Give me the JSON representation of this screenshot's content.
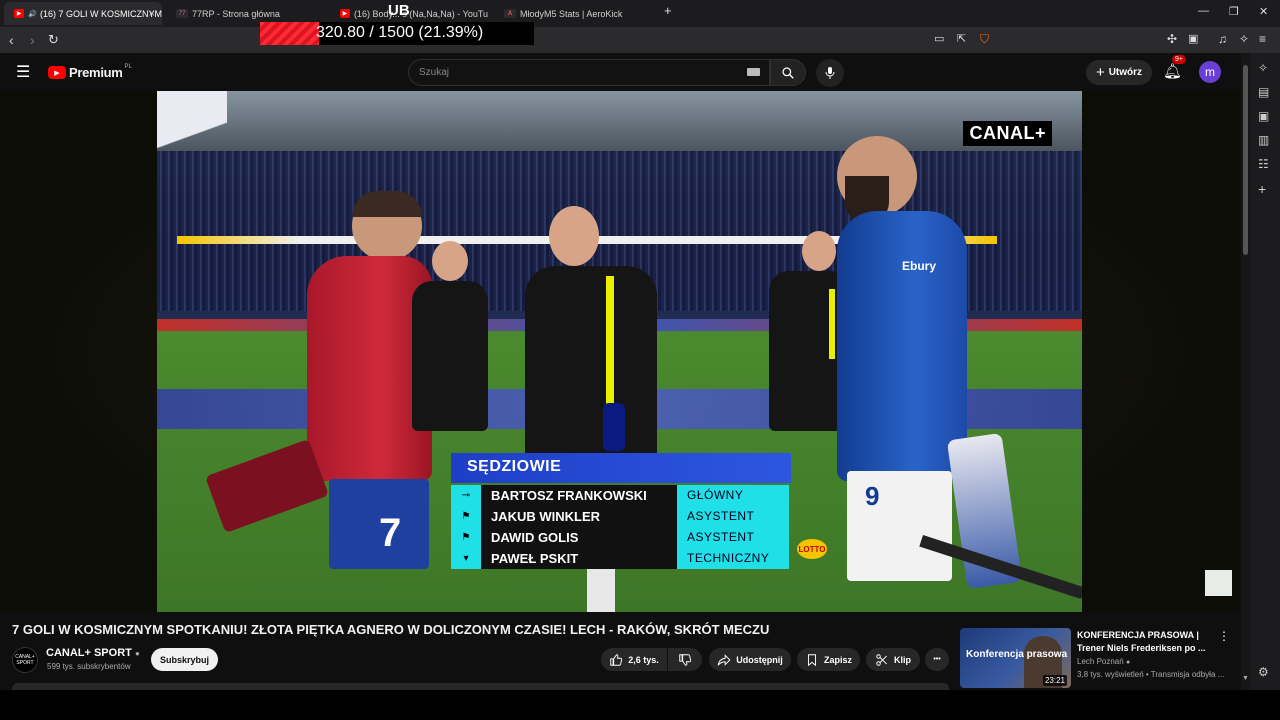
{
  "tabs": [
    {
      "label": "(16) 7 GOLI W KOSMICZNYM",
      "active": true,
      "favicon": "youtube-favicon",
      "close": "×"
    },
    {
      "label": "77RP - Strona główna",
      "active": false,
      "favicon": "77rp-favicon",
      "favicon_text": "77"
    },
    {
      "label": "(16) Body... s (Na,Na,Na) - YouTu",
      "active": false,
      "favicon": "youtube-favicon"
    },
    {
      "label": "MłodyM5 Stats | AeroKick",
      "active": false,
      "favicon": "aerokick-favicon",
      "favicon_text": "A"
    }
  ],
  "new_tab": "+",
  "window": {
    "minimize": "—",
    "restore": "❐",
    "close": "✕"
  },
  "overlay": {
    "top_label": "UB",
    "progress_text": "320.80 / 1500 (21.39%)",
    "progress_value": 320.8,
    "progress_max": 1500,
    "progress_fraction": 0.2139
  },
  "youtube": {
    "logo_text": "Premium",
    "logo_country": "PL",
    "search_placeholder": "Szukaj",
    "create_label": "Utwórz",
    "notif_count": "9+",
    "avatar_letter": "m"
  },
  "video": {
    "channel_bug": "CANAL+",
    "referees_title": "SĘDZIOWIE",
    "referees": [
      {
        "name": "BARTOSZ FRANKOWSKI",
        "role": "GŁÓWNY",
        "icon": "whistle-icon",
        "glyph": "⊸"
      },
      {
        "name": "JAKUB WINKLER",
        "role": "ASYSTENT",
        "icon": "flag-icon",
        "glyph": "⚑"
      },
      {
        "name": "DAWID GOLIS",
        "role": "ASYSTENT",
        "icon": "flag-icon",
        "glyph": "⚑"
      },
      {
        "name": "PAWEŁ PSKIT",
        "role": "TECHNICZNY",
        "icon": "board-icon",
        "glyph": "▾"
      }
    ],
    "sponsor": "LOTTO",
    "shirt_left": "7",
    "shirt_right": "9",
    "sponsor_shirt": "Ebury"
  },
  "info": {
    "title": "7 GOLI W KOSMICZNYM SPOTKANIU! ZŁOTA PIĘTKA AGNERO W DOLICZONYM CZASIE! LECH - RAKÓW, SKRÓT MECZU",
    "channel": "CANAL+ SPORT",
    "channel_avatar": "CANAL+ SPORT",
    "subscribers": "599 tys. subskrybentów",
    "subscribe": "Subskrybuj",
    "likes": "2,6 tys.",
    "share": "Udostępnij",
    "save": "Zapisz",
    "clip": "Klip",
    "more": "•••"
  },
  "recommendation": {
    "thumb_text": "Konferencja prasowa",
    "duration": "23:21",
    "title": "KONFERENCJA PRASOWA | Trener Niels Frederiksen po ...",
    "channel": "Lech Poznań",
    "meta": "3,8 tys. wyświetleń • Transmisja odbyła ..."
  },
  "colors": {
    "youtube_red": "#ff0000",
    "ref_header_blue": "#2d57e0",
    "ref_cyan": "#1fe0e6",
    "overlay_red": "#ff2a35"
  }
}
